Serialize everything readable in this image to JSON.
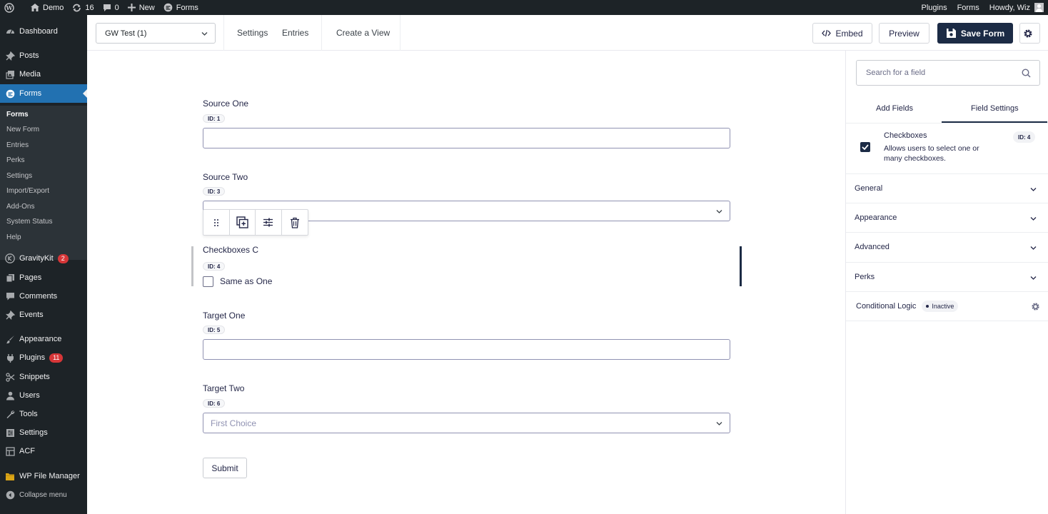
{
  "admin_bar": {
    "site": "Demo",
    "updates": "16",
    "comments": "0",
    "new": "New",
    "forms": "Forms",
    "plugins": "Plugins",
    "forms_right": "Forms",
    "howdy": "Howdy, Wiz"
  },
  "sidebar": {
    "dashboard": "Dashboard",
    "posts": "Posts",
    "media": "Media",
    "forms": "Forms",
    "submenu": [
      "Forms",
      "New Form",
      "Entries",
      "Perks",
      "Settings",
      "Import/Export",
      "Add-Ons",
      "System Status",
      "Help"
    ],
    "gravitykit": "GravityKit",
    "gravitykit_badge": "2",
    "pages": "Pages",
    "comments": "Comments",
    "events": "Events",
    "appearance": "Appearance",
    "plugins": "Plugins",
    "plugins_badge": "11",
    "snippets": "Snippets",
    "users": "Users",
    "tools": "Tools",
    "settings": "Settings",
    "acf": "ACF",
    "wp_file_manager": "WP File Manager",
    "collapse": "Collapse menu"
  },
  "toolbar": {
    "form_name": "GW Test (1)",
    "settings": "Settings",
    "entries": "Entries",
    "create_view": "Create a View",
    "embed": "Embed",
    "preview": "Preview",
    "save": "Save Form"
  },
  "fields": {
    "source_one": {
      "label": "Source One",
      "id": "ID: 1"
    },
    "source_two": {
      "label": "Source Two",
      "id": "ID: 3"
    },
    "checkboxes": {
      "label": "Checkboxes C",
      "id": "ID: 4",
      "choice": "Same as One"
    },
    "target_one": {
      "label": "Target One",
      "id": "ID: 5"
    },
    "target_two": {
      "label": "Target Two",
      "id": "ID: 6",
      "placeholder": "First Choice"
    },
    "submit": "Submit"
  },
  "panel": {
    "search_placeholder": "Search for a field",
    "tab_add": "Add Fields",
    "tab_settings": "Field Settings",
    "field_title": "Checkboxes",
    "field_desc": "Allows users to select one or many checkboxes.",
    "field_id": "ID: 4",
    "sections": [
      "General",
      "Appearance",
      "Advanced",
      "Perks"
    ],
    "conditional_logic": "Conditional Logic",
    "conditional_status": "Inactive"
  },
  "colors": {
    "admin_dark": "#1d2327",
    "wp_blue": "#2271b1",
    "gf_navy": "#1c2b45"
  }
}
